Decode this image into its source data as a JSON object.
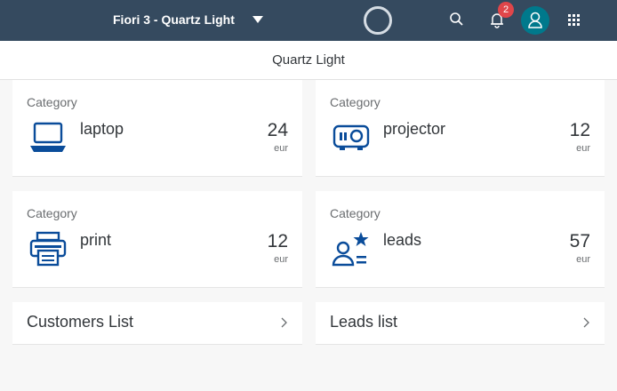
{
  "shell": {
    "app_title": "Fiori 3 - Quartz Light",
    "notification_count": "2"
  },
  "subheader": {
    "title": "Quartz Light"
  },
  "tiles": [
    {
      "category": "Category",
      "label": "laptop",
      "value": "24",
      "unit": "eur",
      "icon": "laptop-icon"
    },
    {
      "category": "Category",
      "label": "projector",
      "value": "12",
      "unit": "eur",
      "icon": "projector-icon"
    },
    {
      "category": "Category",
      "label": "print",
      "value": "12",
      "unit": "eur",
      "icon": "printer-icon"
    },
    {
      "category": "Category",
      "label": "leads",
      "value": "57",
      "unit": "eur",
      "icon": "lead-icon"
    }
  ],
  "lists": [
    {
      "label": "Customers List"
    },
    {
      "label": "Leads list"
    }
  ],
  "colors": {
    "shell": "#354a5f",
    "icon": "#0a4c9a",
    "badge": "#e0464a",
    "avatar": "#00798c"
  }
}
